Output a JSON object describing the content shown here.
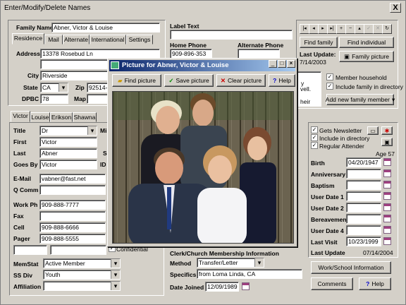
{
  "window": {
    "title": "Enter/Modify/Delete Names",
    "close": "X"
  },
  "family": {
    "name_label": "Family Name",
    "name_value": "Abner, Victor & Louise",
    "tabs": [
      "Residence",
      "Mail",
      "Alternate",
      "International",
      "Settings"
    ],
    "address_label": "Address",
    "address_value": "13378 Rosebud Ln",
    "city_label": "City",
    "city_value": "Riverside",
    "state_label": "State",
    "state_value": "CA",
    "zip_label": "Zip",
    "zip_value": "92514-4",
    "dpbc_label": "DPBC",
    "dpbc_value": "78",
    "map_label": "Map"
  },
  "label_text": {
    "label": "Label Text",
    "home_phone_label": "Home Phone",
    "home_phone_value": "909-896-353",
    "alt_phone_label": "Alternate Phone"
  },
  "right_top": {
    "nav": [
      "|◂",
      "◂",
      "▸",
      "▸|",
      "+",
      "−",
      "▴",
      "✓",
      "✕",
      "↻"
    ],
    "find_family": "Find family",
    "find_individual": "Find individual",
    "last_update_label": "Last Update:",
    "last_update_value": "7/14/2003",
    "family_picture": "Family picture",
    "note_frag1": "y",
    "note_frag2": "vell.",
    "note_frag3": "heir",
    "member_household": "Member household",
    "include_family": "Include family in directory",
    "add_member": "Add new family member"
  },
  "individual": {
    "tabs": [
      "Victor",
      "Louise",
      "Erikson",
      "Shawna"
    ],
    "title_label": "Title",
    "title_value": "Dr",
    "mi_label": "Mi",
    "first_label": "First",
    "first_value": "Victor",
    "last_label": "Last",
    "last_value": "Abner",
    "s_label": "S",
    "goes_by_label": "Goes By",
    "goes_by_value": "Victor",
    "id_label": "ID",
    "email_label": "E-Mail",
    "email_value": "vabner@fast.net",
    "qcomm_label": "Q Comm",
    "workph_label": "Work Ph",
    "workph_value": "909-888-7777",
    "fax_label": "Fax",
    "cell_label": "Cell",
    "cell_value": "909-888-6666",
    "pager_label": "Pager",
    "pager_value": "909-888-5555",
    "confidential": "Confidential",
    "memstat_label": "MemStat",
    "memstat_value": "Active Member",
    "ssdiv_label": "SS Div",
    "ssdiv_value": "Youth",
    "affiliation_label": "Affiliation"
  },
  "clerk": {
    "header": "Clerk/Church Membership Information",
    "method_label": "Method",
    "method_value": "Transfer/Letter",
    "specifics_label": "Specifics",
    "specifics_value": "from Loma Linda, CA",
    "joined_label": "Date Joined",
    "joined_value": "12/09/1989"
  },
  "right_panel": {
    "gets_newsletter": "Gets Newsletter",
    "include_directory": "Include in directory",
    "regular_attender": "Regular Attender",
    "age": "Age 57",
    "birth_label": "Birth",
    "birth_value": "04/20/1947",
    "anniversary_label": "Anniversary",
    "baptism_label": "Baptism",
    "ud1_label": "User Date 1",
    "ud2_label": "User Date 2",
    "bereavement_label": "Bereavement",
    "ud4_label": "User Date 4",
    "last_visit_label": "Last Visit",
    "last_visit_value": "10/23/1999",
    "last_update_label": "Last Update",
    "last_update_value": "07/14/2004",
    "work_school": "Work/School Information",
    "comments": "Comments",
    "help": "Help"
  },
  "popup": {
    "title": "Picture for Abner, Victor & Louise",
    "find": "Find picture",
    "save": "Save picture",
    "clear": "Clear picture",
    "help": "Help"
  }
}
